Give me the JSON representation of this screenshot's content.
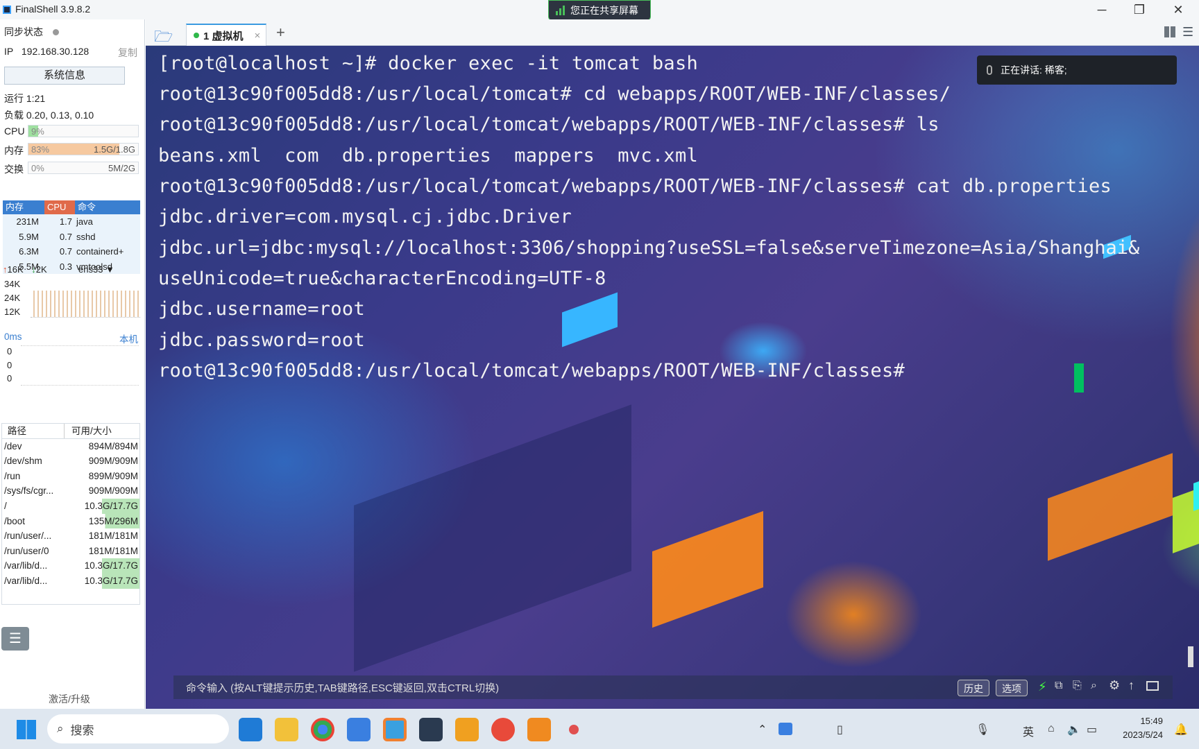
{
  "app": {
    "title": "FinalShell 3.9.8.2"
  },
  "share_banner": "您正在共享屏幕",
  "sidebar": {
    "sync_label": "同步状态",
    "ip_label": "IP",
    "ip": "192.168.30.128",
    "copy": "复制",
    "sysinfo_button": "系统信息",
    "uptime": "运行 1:21",
    "load": "负载 0.20, 0.13, 0.10",
    "cpu": {
      "label": "CPU",
      "text": "9%",
      "percent": 9
    },
    "mem": {
      "label": "内存",
      "text": "83%",
      "value": "1.5G/1.8G",
      "percent": 83
    },
    "swap": {
      "label": "交换",
      "text": "0%",
      "value": "5M/2G",
      "percent": 0
    },
    "proc_headers": [
      "内存",
      "CPU",
      "命令"
    ],
    "procs": [
      {
        "mem": "231M",
        "cpu": "1.7",
        "cmd": "java"
      },
      {
        "mem": "5.9M",
        "cpu": "0.7",
        "cmd": "sshd"
      },
      {
        "mem": "6.3M",
        "cpu": "0.7",
        "cmd": "containerd+"
      },
      {
        "mem": "5.5M",
        "cpu": "0.3",
        "cmd": "vmtoolsd"
      }
    ],
    "net": {
      "up": "16K",
      "down": "2K",
      "iface": "ens33",
      "ticks": [
        "34K",
        "24K",
        "12K"
      ]
    },
    "ping": {
      "ms": "0ms",
      "host": "本机",
      "vals": [
        "0",
        "0",
        "0"
      ]
    },
    "fs_headers": [
      "路径",
      "可用/大小"
    ],
    "fs": [
      {
        "path": "/dev",
        "size": "894M/894M"
      },
      {
        "path": "/dev/shm",
        "size": "909M/909M"
      },
      {
        "path": "/run",
        "size": "899M/909M"
      },
      {
        "path": "/sys/fs/cgr...",
        "size": "909M/909M"
      },
      {
        "path": "/",
        "size": "10.3G/17.7G"
      },
      {
        "path": "/boot",
        "size": "135M/296M"
      },
      {
        "path": "/run/user/...",
        "size": "181M/181M"
      },
      {
        "path": "/run/user/0",
        "size": "181M/181M"
      },
      {
        "path": "/var/lib/d...",
        "size": "10.3G/17.7G"
      },
      {
        "path": "/var/lib/d...",
        "size": "10.3G/17.7G"
      }
    ],
    "activate": "激活/升级"
  },
  "tab": {
    "label": "1 虚拟机",
    "close": "×",
    "add": "+"
  },
  "speaking": "正在讲话:  稀客;",
  "terminal": {
    "lines": [
      "[root@localhost ~]# docker exec -it tomcat bash",
      "root@13c90f005dd8:/usr/local/tomcat# cd webapps/ROOT/WEB-INF/classes/",
      "root@13c90f005dd8:/usr/local/tomcat/webapps/ROOT/WEB-INF/classes# ls",
      "beans.xml  com  db.properties  mappers  mvc.xml",
      "root@13c90f005dd8:/usr/local/tomcat/webapps/ROOT/WEB-INF/classes# cat db.properties",
      "jdbc.driver=com.mysql.cj.jdbc.Driver",
      "jdbc.url=jdbc:mysql://localhost:3306/shopping?useSSL=false&serveTimezone=Asia/Shanghai&",
      "useUnicode=true&characterEncoding=UTF-8",
      "jdbc.username=root",
      "jdbc.password=root",
      "root@13c90f005dd8:/usr/local/tomcat/webapps/ROOT/WEB-INF/classes# "
    ]
  },
  "cmdbar": {
    "hint": "命令输入 (按ALT键提示历史,TAB键路径,ESC键返回,双击CTRL切换)",
    "history": "历史",
    "options": "选项"
  },
  "taskbar": {
    "search": "搜索",
    "ime": "英",
    "time": "15:49",
    "date": "2023/5/24"
  },
  "colors": {
    "accent": "#3a9ae0",
    "cursor": "#00c060",
    "mem_fill": "#f6c9a0",
    "cpu_fill": "#9fe0a0"
  }
}
